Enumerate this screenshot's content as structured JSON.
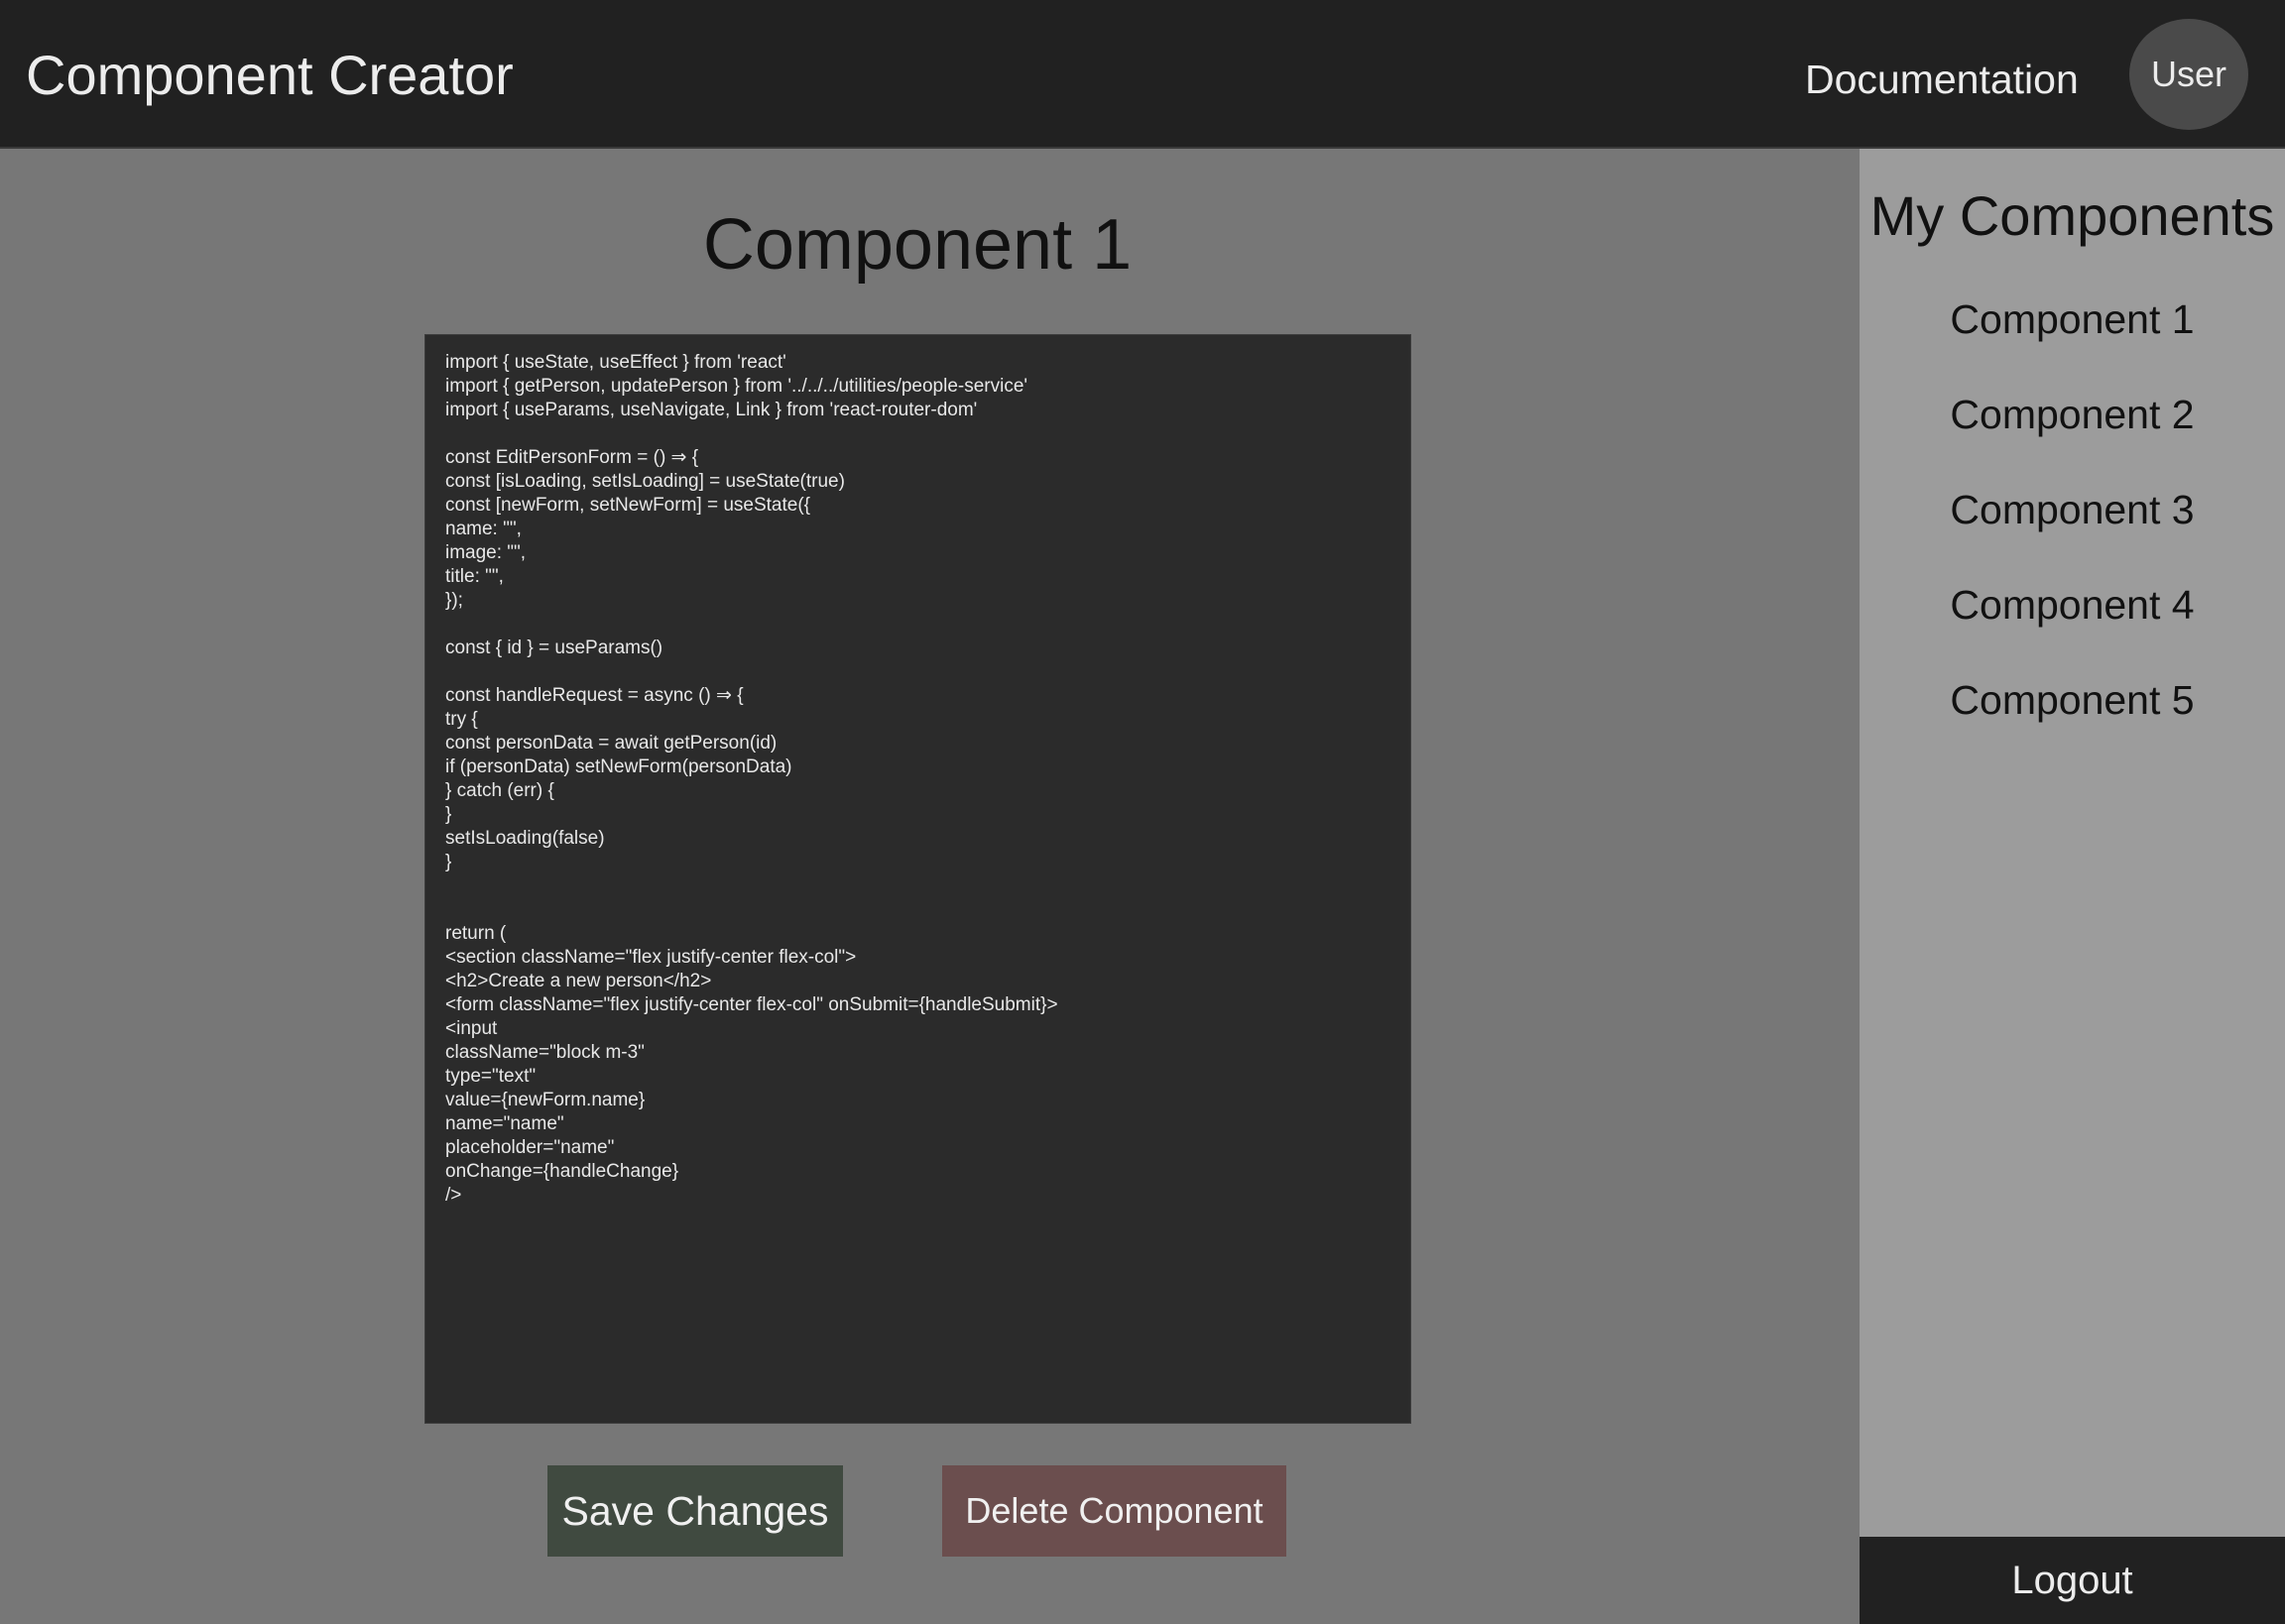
{
  "header": {
    "title": "Component Creator",
    "documentation_link": "Documentation",
    "user_label": "User"
  },
  "main": {
    "component_title": "Component 1",
    "code": "import { useState, useEffect } from 'react'\nimport { getPerson, updatePerson } from '../../../utilities/people-service'\nimport { useParams, useNavigate, Link } from 'react-router-dom'\n\nconst EditPersonForm = () ⇒ {\nconst [isLoading, setIsLoading] = useState(true)\nconst [newForm, setNewForm] = useState({\nname: \"\",\nimage: \"\",\ntitle: \"\",\n});\n\nconst { id } = useParams()\n\nconst handleRequest = async () ⇒ {\ntry {\nconst personData = await getPerson(id)\nif (personData) setNewForm(personData)\n} catch (err) {\n}\nsetIsLoading(false)\n}\n\n\nreturn (\n<section className=\"flex justify-center flex-col\">\n<h2>Create a new person</h2>\n<form className=\"flex justify-center flex-col\" onSubmit={handleSubmit}>\n<input\nclassName=\"block m-3\"\ntype=\"text\"\nvalue={newForm.name}\nname=\"name\"\nplaceholder=\"name\"\nonChange={handleChange}\n/>",
    "save_label": "Save Changes",
    "delete_label": "Delete Component"
  },
  "sidebar": {
    "heading": "My Components",
    "items": [
      {
        "label": "Component 1"
      },
      {
        "label": "Component 2"
      },
      {
        "label": "Component 3"
      },
      {
        "label": "Component 4"
      },
      {
        "label": "Component 5"
      }
    ],
    "logout_label": "Logout"
  },
  "colors": {
    "header_bg": "#212121",
    "main_bg": "#777777",
    "sidebar_bg": "#9c9c9c",
    "editor_bg": "#2b2b2b",
    "save_bg": "#404a40",
    "delete_bg": "#6b4e4e"
  }
}
